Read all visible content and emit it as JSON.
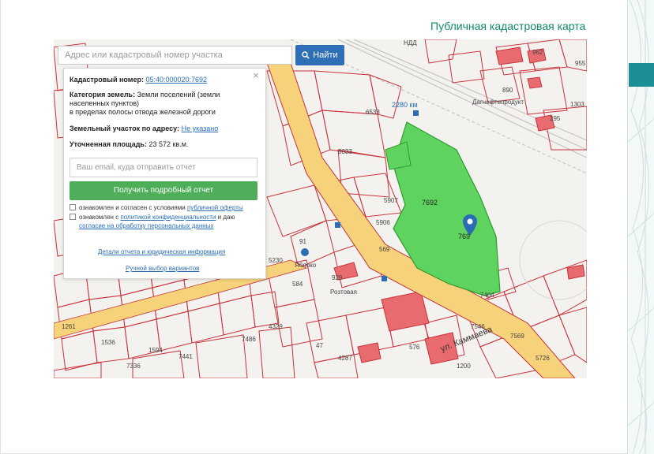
{
  "page": {
    "title": "Публичная кадастровая карта"
  },
  "search": {
    "placeholder": "Адрес или кадастровый номер участка",
    "button_label": "Найти",
    "button_icon": "search-icon"
  },
  "panel": {
    "close_symbol": "×",
    "cadastral_label": "Кадастровый номер:",
    "cadastral_value": "05:40:000020:7692",
    "category_label": "Категория земель:",
    "category_value_line1": "Земли поселений (земли",
    "category_value_line2": "населенных пунктов)",
    "category_value_line3": "в пределах полосы отвода железной дороги",
    "address_label": "Земельный участок по адресу:",
    "address_value": "Не указано",
    "area_label": "Уточненная площадь:",
    "area_value": "23 572 кв.м.",
    "email_placeholder": "Ваш email, куда отправить отчет",
    "report_button": "Получить подробный отчет",
    "consent1_text": "ознакомлен и согласен с условиями",
    "consent1_link": "публичной оферты",
    "consent2_text": "ознакомлен с",
    "consent2_link1": "политикой конфиденциальности",
    "consent2_text2": "и даю",
    "consent2_link2": "согласие на обработку персональных данных",
    "details_link": "Детали отчета и юридическая информация",
    "manual_link": "Ручной выбор вариантов"
  },
  "map": {
    "colors": {
      "parcel_border": "#c8323c",
      "selected_fill": "#5fd35f",
      "road_fill": "#f6d37a",
      "road_border": "#c8323c",
      "background": "#f4f2ef",
      "accent": "#1b8e96"
    },
    "labels": {
      "station": "2280 км",
      "company": "Дагнефтепродукт",
      "street": "ул. Каммаева",
      "parcel_main": "7692",
      "parcel_main_short": "769",
      "shop_label": "Яблоко",
      "store_label": "Розтовая",
      "hdd": "НДД"
    },
    "numbers": [
      "6533",
      "6033",
      "5907",
      "5906",
      "569",
      "584",
      "929",
      "7404",
      "7486",
      "4329",
      "7546",
      "7569",
      "576",
      "47",
      "890",
      "295",
      "1303",
      "955",
      "962",
      "4287",
      "91",
      "5230",
      "5726",
      "7336",
      "1261",
      "7441",
      "1200",
      "1536",
      "1594"
    ]
  }
}
